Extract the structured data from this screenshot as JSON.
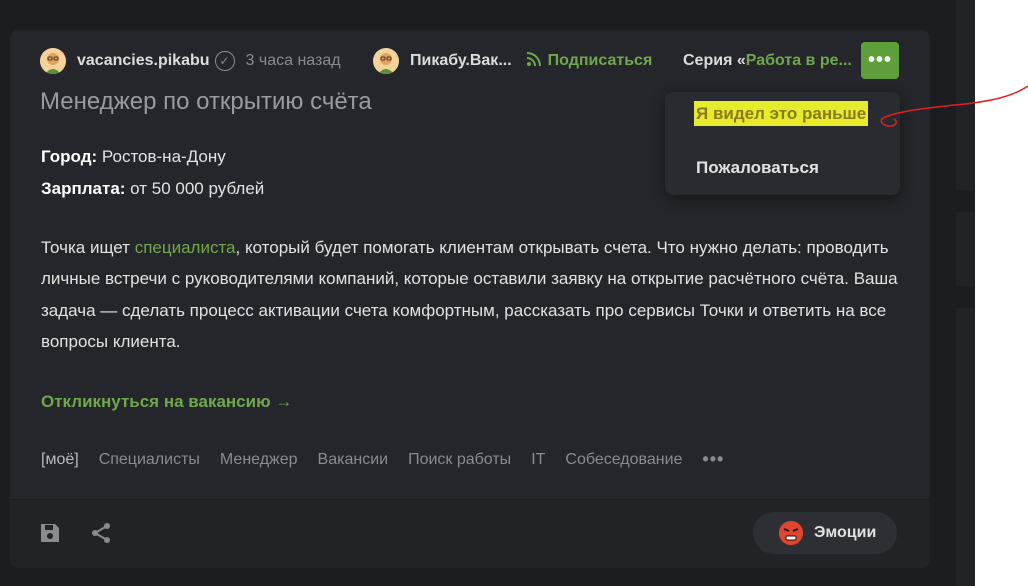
{
  "post": {
    "author": "vacancies.pikabu",
    "time": "3 часа назад",
    "community": "Пикабу.Вак...",
    "subscribe": "Подписаться",
    "series_prefix": "Серия «",
    "series_name": "Работа в ре...",
    "title": "Менеджер по открытию счёта",
    "city_label": "Город:",
    "city_value": " Ростов-на-Дону",
    "salary_label": "Зарплата:",
    "salary_value": " от 50 000 рублей",
    "body_before_link": "Точка ищет ",
    "body_link": "специалиста",
    "body_after_link": ", который будет помогать клиентам открывать счета. Что нужно делать: проводить личные встречи с руководителями компаний, которые оставили заявку на открытие расчётного счёта. Ваша задача — сделать процесс активации счета комфортным, рассказать про сервисы Точки и ответить на все вопросы клиента.",
    "apply": "Откликнуться на вакансию →",
    "tags": [
      "[моё]",
      "Специалисты",
      "Менеджер",
      "Вакансии",
      "Поиск работы",
      "IT",
      "Собеседование"
    ],
    "emotions": "Эмоции"
  },
  "menu": {
    "items": [
      "Я видел это раньше",
      "Пожаловаться"
    ]
  },
  "icons": {
    "more": "ellipsis-icon",
    "save": "floppy-disk-icon",
    "share": "share-icon",
    "rss": "rss-icon",
    "verified": "check-circle-icon",
    "emotion": "angry-face-icon"
  },
  "colors": {
    "accent_green": "#6fa84a",
    "button_green": "#5e9e3b",
    "highlight_yellow": "#e6ec2a",
    "annotation_red": "#e02020",
    "card_bg": "#25262b",
    "page_bg": "#1c1d21"
  }
}
